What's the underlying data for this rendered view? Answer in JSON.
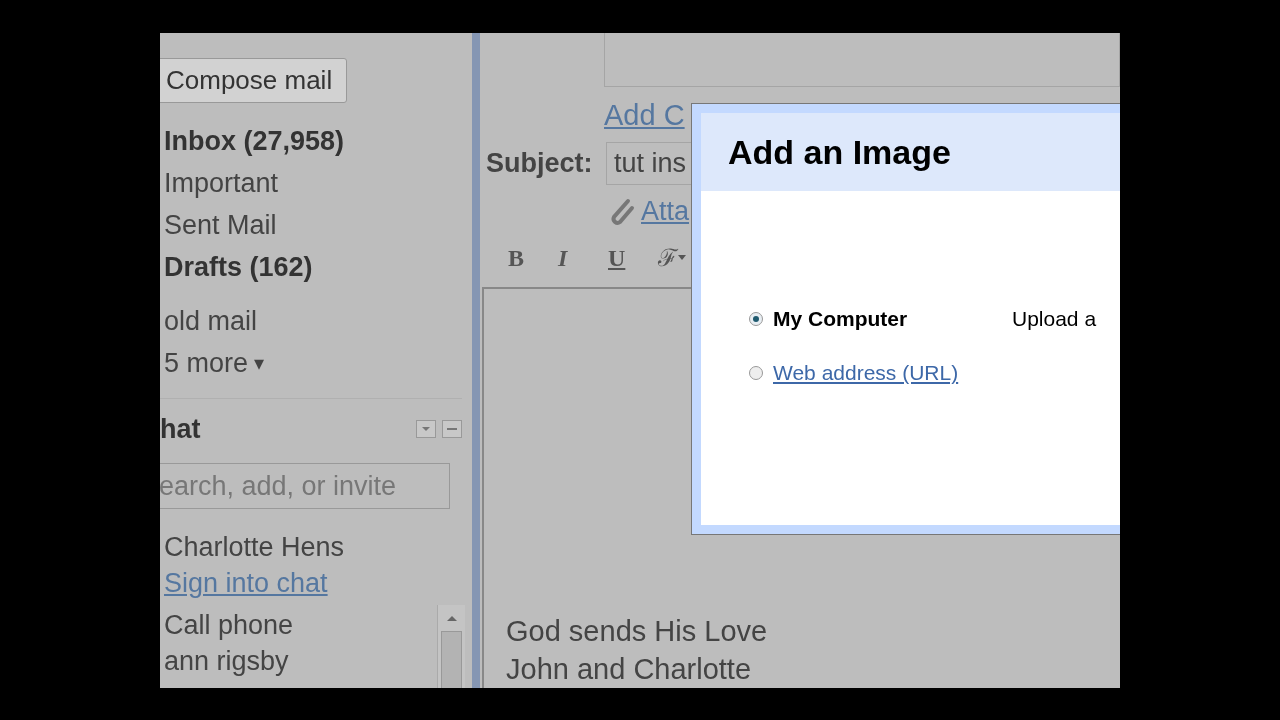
{
  "compose_button": "Compose mail",
  "folders": [
    {
      "label": "Inbox (27,958)",
      "bold": true
    },
    {
      "label": "Important",
      "bold": false
    },
    {
      "label": "Sent Mail",
      "bold": false
    },
    {
      "label": "Drafts (162)",
      "bold": true
    },
    {
      "label": "old mail",
      "bold": false
    }
  ],
  "more": {
    "label": "5 more",
    "arrow": "▾"
  },
  "chat": {
    "title": "hat",
    "search_placeholder": "earch, add, or invite",
    "user": "Charlotte Hens",
    "sign_in": "Sign into chat",
    "contacts": [
      "Call phone",
      "ann rigsby"
    ]
  },
  "compose": {
    "add_link": "Add C",
    "subject_label": "Subject:",
    "subject_value": "tut ins",
    "attach_link": "Atta",
    "toolbar": [
      {
        "label": "B",
        "kind": "bold"
      },
      {
        "label": "I",
        "kind": "italic"
      },
      {
        "label": "U",
        "kind": "underline"
      },
      {
        "label": "ℱ",
        "kind": "font"
      }
    ],
    "body_lines": [
      "God sends His Love",
      "John and Charlotte"
    ]
  },
  "dialog": {
    "title": "Add an Image",
    "options": [
      {
        "kind": "label",
        "label": "My Computer",
        "selected": true,
        "description": "Upload a"
      },
      {
        "kind": "link",
        "label": "Web address (URL)",
        "selected": false
      }
    ]
  }
}
